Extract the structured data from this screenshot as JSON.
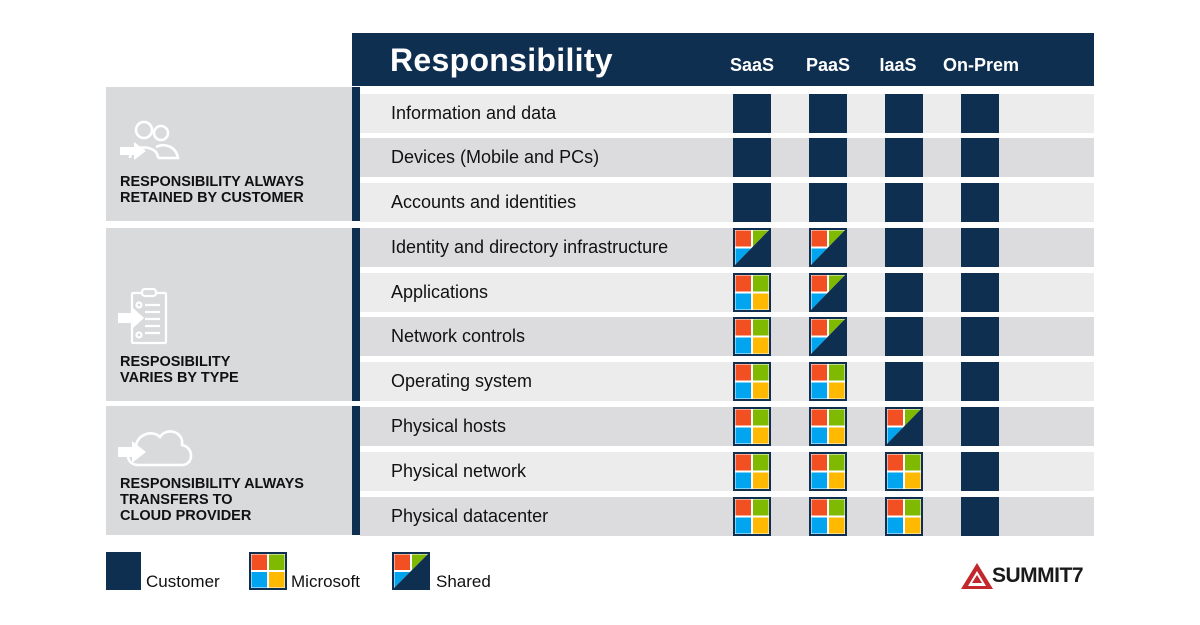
{
  "header": {
    "title": "Responsibility",
    "columns": [
      "SaaS",
      "PaaS",
      "IaaS",
      "On-Prem"
    ]
  },
  "colors": {
    "navy": "#0f2f50",
    "red": "#f25022",
    "green": "#7fba00",
    "blue": "#00a4ef",
    "yellow": "#ffb900",
    "logo_red": "#c1272d"
  },
  "groups": [
    {
      "label_line1": "RESPONSIBILITY ALWAYS",
      "label_line2": "RETAINED BY CUSTOMER",
      "label_line3": "",
      "icon": "users-arrow-icon"
    },
    {
      "label_line1": "RESPOSIBILITY",
      "label_line2": "VARIES BY TYPE",
      "label_line3": "",
      "icon": "clipboard-arrow-icon"
    },
    {
      "label_line1": "RESPONSIBILITY ALWAYS",
      "label_line2": "TRANSFERS TO",
      "label_line3": "CLOUD PROVIDER",
      "icon": "cloud-arrow-icon"
    }
  ],
  "rows": [
    {
      "label": "Information and data",
      "cells": [
        "customer",
        "customer",
        "customer",
        "customer"
      ]
    },
    {
      "label": "Devices (Mobile and PCs)",
      "cells": [
        "customer",
        "customer",
        "customer",
        "customer"
      ]
    },
    {
      "label": "Accounts and identities",
      "cells": [
        "customer",
        "customer",
        "customer",
        "customer"
      ]
    },
    {
      "label": "Identity and directory infrastructure",
      "cells": [
        "shared",
        "shared",
        "customer",
        "customer"
      ]
    },
    {
      "label": "Applications",
      "cells": [
        "microsoft",
        "shared",
        "customer",
        "customer"
      ]
    },
    {
      "label": "Network controls",
      "cells": [
        "microsoft",
        "shared",
        "customer",
        "customer"
      ]
    },
    {
      "label": "Operating system",
      "cells": [
        "microsoft",
        "microsoft",
        "customer",
        "customer"
      ]
    },
    {
      "label": "Physical hosts",
      "cells": [
        "microsoft",
        "microsoft",
        "shared",
        "customer"
      ]
    },
    {
      "label": "Physical network",
      "cells": [
        "microsoft",
        "microsoft",
        "microsoft",
        "customer"
      ]
    },
    {
      "label": "Physical datacenter",
      "cells": [
        "microsoft",
        "microsoft",
        "microsoft",
        "customer"
      ]
    }
  ],
  "legend": [
    {
      "key": "customer",
      "label": "Customer"
    },
    {
      "key": "microsoft",
      "label": "Microsoft"
    },
    {
      "key": "shared",
      "label": "Shared"
    }
  ],
  "logo": {
    "text": "SUMMIT7"
  }
}
